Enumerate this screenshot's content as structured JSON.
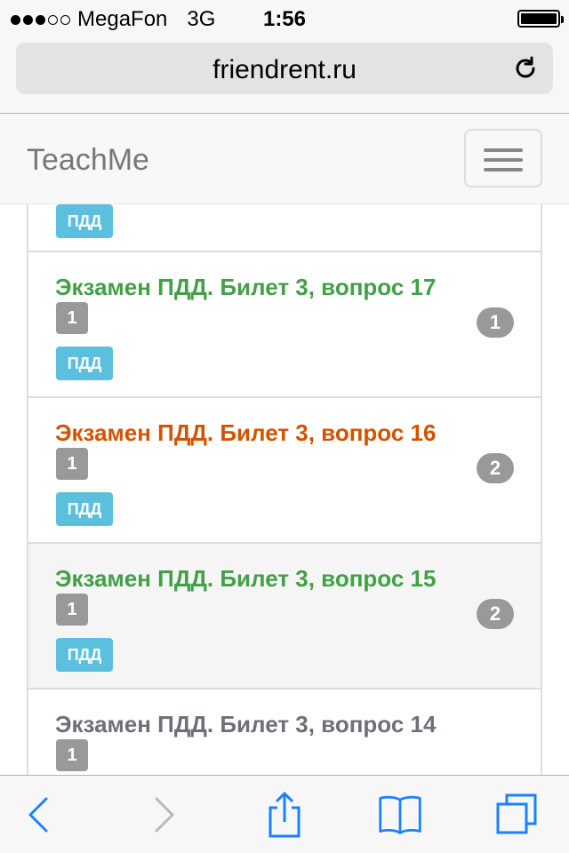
{
  "status_bar": {
    "carrier": "MegaFon",
    "network": "3G",
    "time": "1:56",
    "signal_bars": 3
  },
  "browser": {
    "url": "friendrent.ru",
    "reload_icon": "reload-icon"
  },
  "navbar": {
    "brand": "TeachMe",
    "menu_icon": "hamburger-icon"
  },
  "colors": {
    "green": "#43a047",
    "orange": "#d35400",
    "gray_title": "#6f6f7a",
    "label_gray": "#999999",
    "tag_blue": "#5bc0de"
  },
  "list": {
    "partial_tag": "ПДД",
    "items": [
      {
        "title": "Экзамен ПДД. Билет 3, вопрос 17",
        "label": "1",
        "tag": "ПДД",
        "count": "1",
        "color": "#43a047"
      },
      {
        "title": "Экзамен ПДД. Билет 3, вопрос 16",
        "label": "1",
        "tag": "ПДД",
        "count": "2",
        "color": "#d35400"
      },
      {
        "title": "Экзамен ПДД. Билет 3, вопрос 15",
        "label": "1",
        "tag": "ПДД",
        "count": "2",
        "color": "#43a047"
      },
      {
        "title": "Экзамен ПДД. Билет 3, вопрос 14",
        "label": "1",
        "tag": "",
        "count": "",
        "color": "#6f6f7a"
      }
    ]
  },
  "toolbar": {
    "back_icon": "back-arrow-icon",
    "forward_icon": "forward-arrow-icon",
    "share_icon": "share-icon",
    "bookmarks_icon": "bookmarks-icon",
    "tabs_icon": "tabs-icon"
  }
}
